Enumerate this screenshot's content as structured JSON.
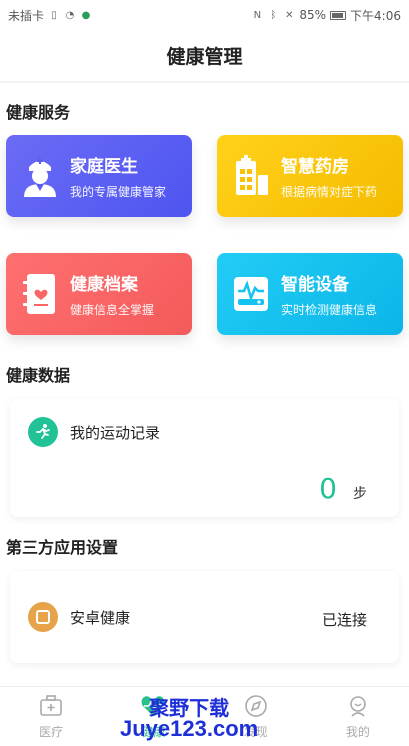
{
  "status_bar": {
    "carrier": "未插卡",
    "battery_percent": "85%",
    "time": "下午4:06"
  },
  "header": {
    "title": "健康管理"
  },
  "services": {
    "title": "健康服务",
    "cards": [
      {
        "title": "家庭医生",
        "subtitle": "我的专属健康管家",
        "icon": "doctor-icon",
        "color": "#5b5cf2"
      },
      {
        "title": "智慧药房",
        "subtitle": "根据病情对症下药",
        "icon": "pharmacy-icon",
        "color": "#f8c300"
      },
      {
        "title": "健康档案",
        "subtitle": "健康信息全掌握",
        "icon": "health-record-icon",
        "color": "#fa6666"
      },
      {
        "title": "智能设备",
        "subtitle": "实时检测健康信息",
        "icon": "smart-device-icon",
        "color": "#16c3f0"
      }
    ]
  },
  "health_data": {
    "title": "健康数据",
    "exercise": {
      "label": "我的运动记录",
      "value": "0",
      "unit": "步",
      "icon": "running-icon"
    }
  },
  "third_party": {
    "title": "第三方应用设置",
    "app": {
      "name": "安卓健康",
      "status": "已连接",
      "icon": "android-health-icon"
    }
  },
  "tab_bar": {
    "tabs": [
      {
        "label": "医疗",
        "icon": "medical-kit-icon"
      },
      {
        "label": "健康",
        "icon": "heart-pulse-icon",
        "active": true
      },
      {
        "label": "发现",
        "icon": "compass-icon"
      },
      {
        "label": "我的",
        "icon": "profile-icon"
      }
    ]
  },
  "watermark": {
    "line1": "聚野下载",
    "line2": "Juye123.com"
  }
}
